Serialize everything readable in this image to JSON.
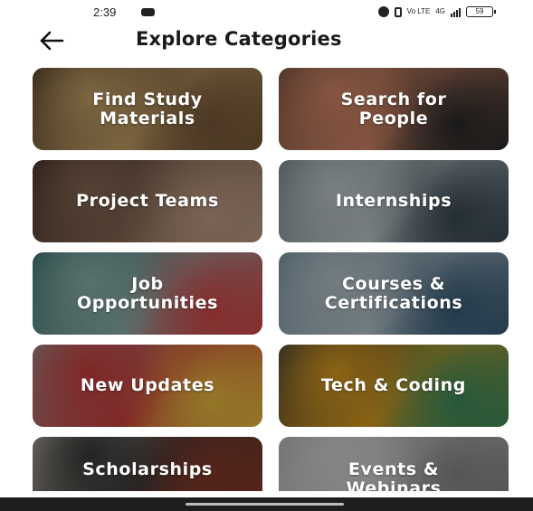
{
  "status_bar": {
    "time": "2:39",
    "network": "Vo LTE",
    "signal_label": "4G",
    "battery": "59"
  },
  "header": {
    "title": "Explore Categories"
  },
  "categories": [
    {
      "label": "Find Study\nMaterials",
      "colors": [
        "#3b2a1a",
        "#c9a46a",
        "#7a5a3a"
      ]
    },
    {
      "label": "Search for\nPeople",
      "colors": [
        "#6a4a3a",
        "#d98a6a",
        "#2a2a2a"
      ]
    },
    {
      "label": "Project Teams",
      "colors": [
        "#3a2a22",
        "#8a6a55",
        "#c2a088"
      ]
    },
    {
      "label": "Internships",
      "colors": [
        "#6c7a80",
        "#c5cfd2",
        "#3a4a55"
      ]
    },
    {
      "label": "Job\nOpportunities",
      "colors": [
        "#2f6b66",
        "#8fb5b0",
        "#d84a4a"
      ]
    },
    {
      "label": "Courses &\nCertifications",
      "colors": [
        "#6f8ea0",
        "#b9c9d0",
        "#3a5f7a"
      ]
    },
    {
      "label": "New Updates",
      "colors": [
        "#9a9a9a",
        "#d04040",
        "#f0c040"
      ]
    },
    {
      "label": "Tech & Coding",
      "colors": [
        "#2a2f3a",
        "#e0a020",
        "#3f8f5f"
      ]
    },
    {
      "label": "Scholarships",
      "colors": [
        "#c8c0b0",
        "#3a3a3a",
        "#8a3a2a"
      ]
    },
    {
      "label": "Events &\nWebinars",
      "colors": [
        "#b0b0b0",
        "#d8d8d8",
        "#8a8a8a"
      ]
    }
  ]
}
